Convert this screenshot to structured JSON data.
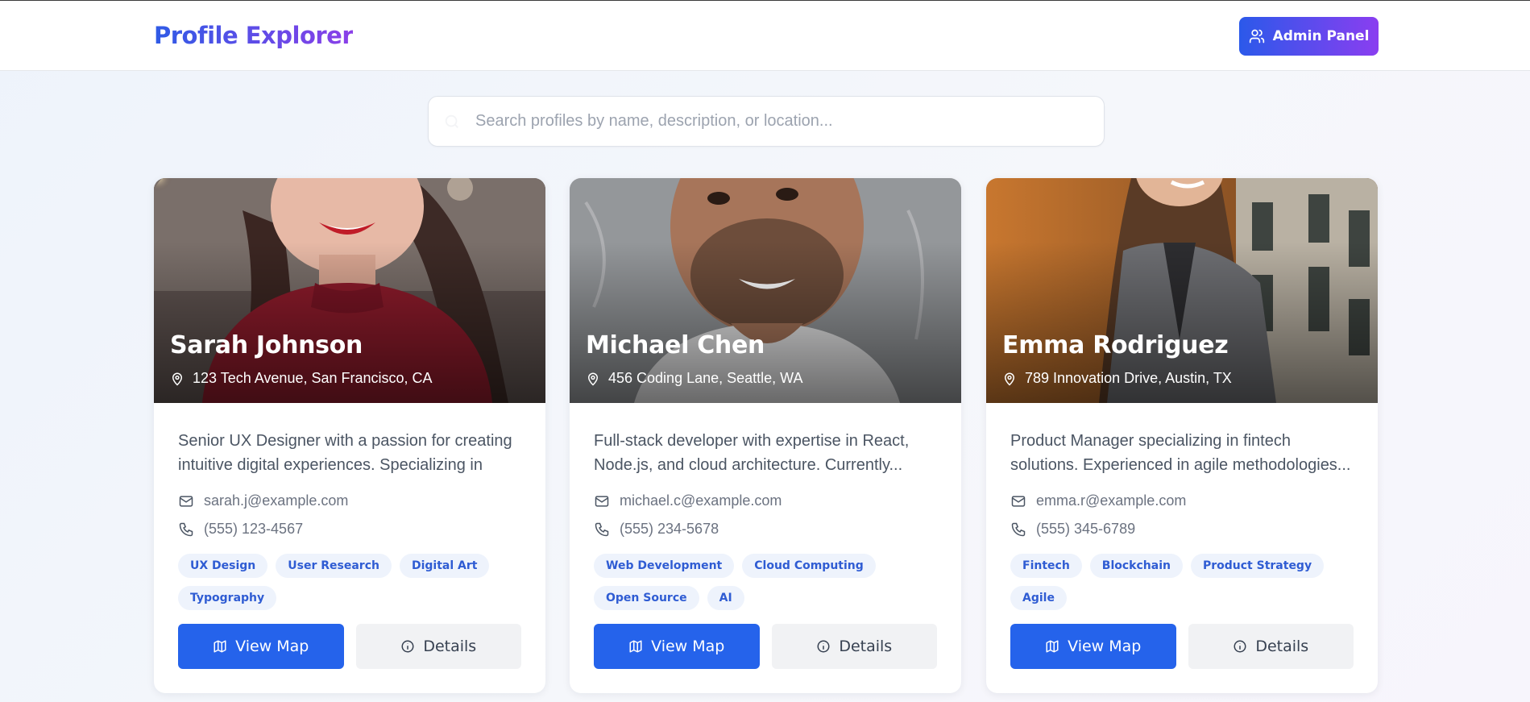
{
  "app": {
    "title": "Profile Explorer"
  },
  "header": {
    "admin_label": "Admin Panel",
    "admin_icon": "users-icon"
  },
  "search": {
    "placeholder": "Search profiles by name, description, or location...",
    "value": ""
  },
  "colors": {
    "accent": "#2563eb",
    "brand_gradient_start": "#2f5be6",
    "brand_gradient_end": "#8b3fe8",
    "tag_bg": "#eef3fc",
    "tag_text": "#2f5cd3"
  },
  "profiles": [
    {
      "name": "Sarah Johnson",
      "location": "123 Tech Avenue, San Francisco, CA",
      "description": "Senior UX Designer with a passion for creating intuitive digital experiences. Specializing in use...",
      "email": "sarah.j@example.com",
      "phone": "(555) 123-4567",
      "tags": [
        "UX Design",
        "User Research",
        "Digital Art",
        "Typography"
      ],
      "map_label": "View Map",
      "details_label": "Details"
    },
    {
      "name": "Michael Chen",
      "location": "456 Coding Lane, Seattle, WA",
      "description": "Full-stack developer with expertise in React, Node.js, and cloud architecture. Currently...",
      "email": "michael.c@example.com",
      "phone": "(555) 234-5678",
      "tags": [
        "Web Development",
        "Cloud Computing",
        "Open Source",
        "AI"
      ],
      "map_label": "View Map",
      "details_label": "Details"
    },
    {
      "name": "Emma Rodriguez",
      "location": "789 Innovation Drive, Austin, TX",
      "description": "Product Manager specializing in fintech solutions. Experienced in agile methodologies...",
      "email": "emma.r@example.com",
      "phone": "(555) 345-6789",
      "tags": [
        "Fintech",
        "Blockchain",
        "Product Strategy",
        "Agile"
      ],
      "map_label": "View Map",
      "details_label": "Details"
    }
  ]
}
